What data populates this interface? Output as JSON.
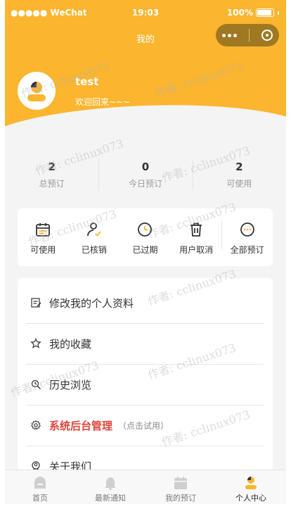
{
  "status_bar": {
    "carrier": "●●●●● WeChat",
    "time": "19:03",
    "battery": "100%"
  },
  "nav": {
    "title": "我的"
  },
  "user": {
    "name": "test",
    "welcome": "欢迎回来~~~"
  },
  "stats": [
    {
      "value": "2",
      "label": "总预订"
    },
    {
      "value": "0",
      "label": "今日预订"
    },
    {
      "value": "2",
      "label": "可使用"
    }
  ],
  "orders": [
    {
      "label": "可使用",
      "icon": "calendar-icon"
    },
    {
      "label": "已核销",
      "icon": "user-check-icon"
    },
    {
      "label": "已过期",
      "icon": "clock-icon"
    },
    {
      "label": "用户取消",
      "icon": "trash-icon"
    },
    {
      "label": "全部预订",
      "icon": "more-circle-icon"
    }
  ],
  "menu": [
    {
      "label": "修改我的个人资料",
      "icon": "edit-icon"
    },
    {
      "label": "我的收藏",
      "icon": "star-icon"
    },
    {
      "label": "历史浏览",
      "icon": "history-icon"
    },
    {
      "label": "系统后台管理",
      "hint": "（点击试用）",
      "icon": "gear-icon"
    },
    {
      "label": "关于我们",
      "icon": "about-icon"
    }
  ],
  "tabs": [
    {
      "label": "首页",
      "icon": "home-icon"
    },
    {
      "label": "最新通知",
      "icon": "bell-icon"
    },
    {
      "label": "我的预订",
      "icon": "calendar-icon"
    },
    {
      "label": "个人中心",
      "icon": "profile-icon"
    }
  ],
  "watermark": "作者: cclinux073",
  "colors": {
    "accent": "#fbb52e",
    "danger": "#e0463b"
  }
}
